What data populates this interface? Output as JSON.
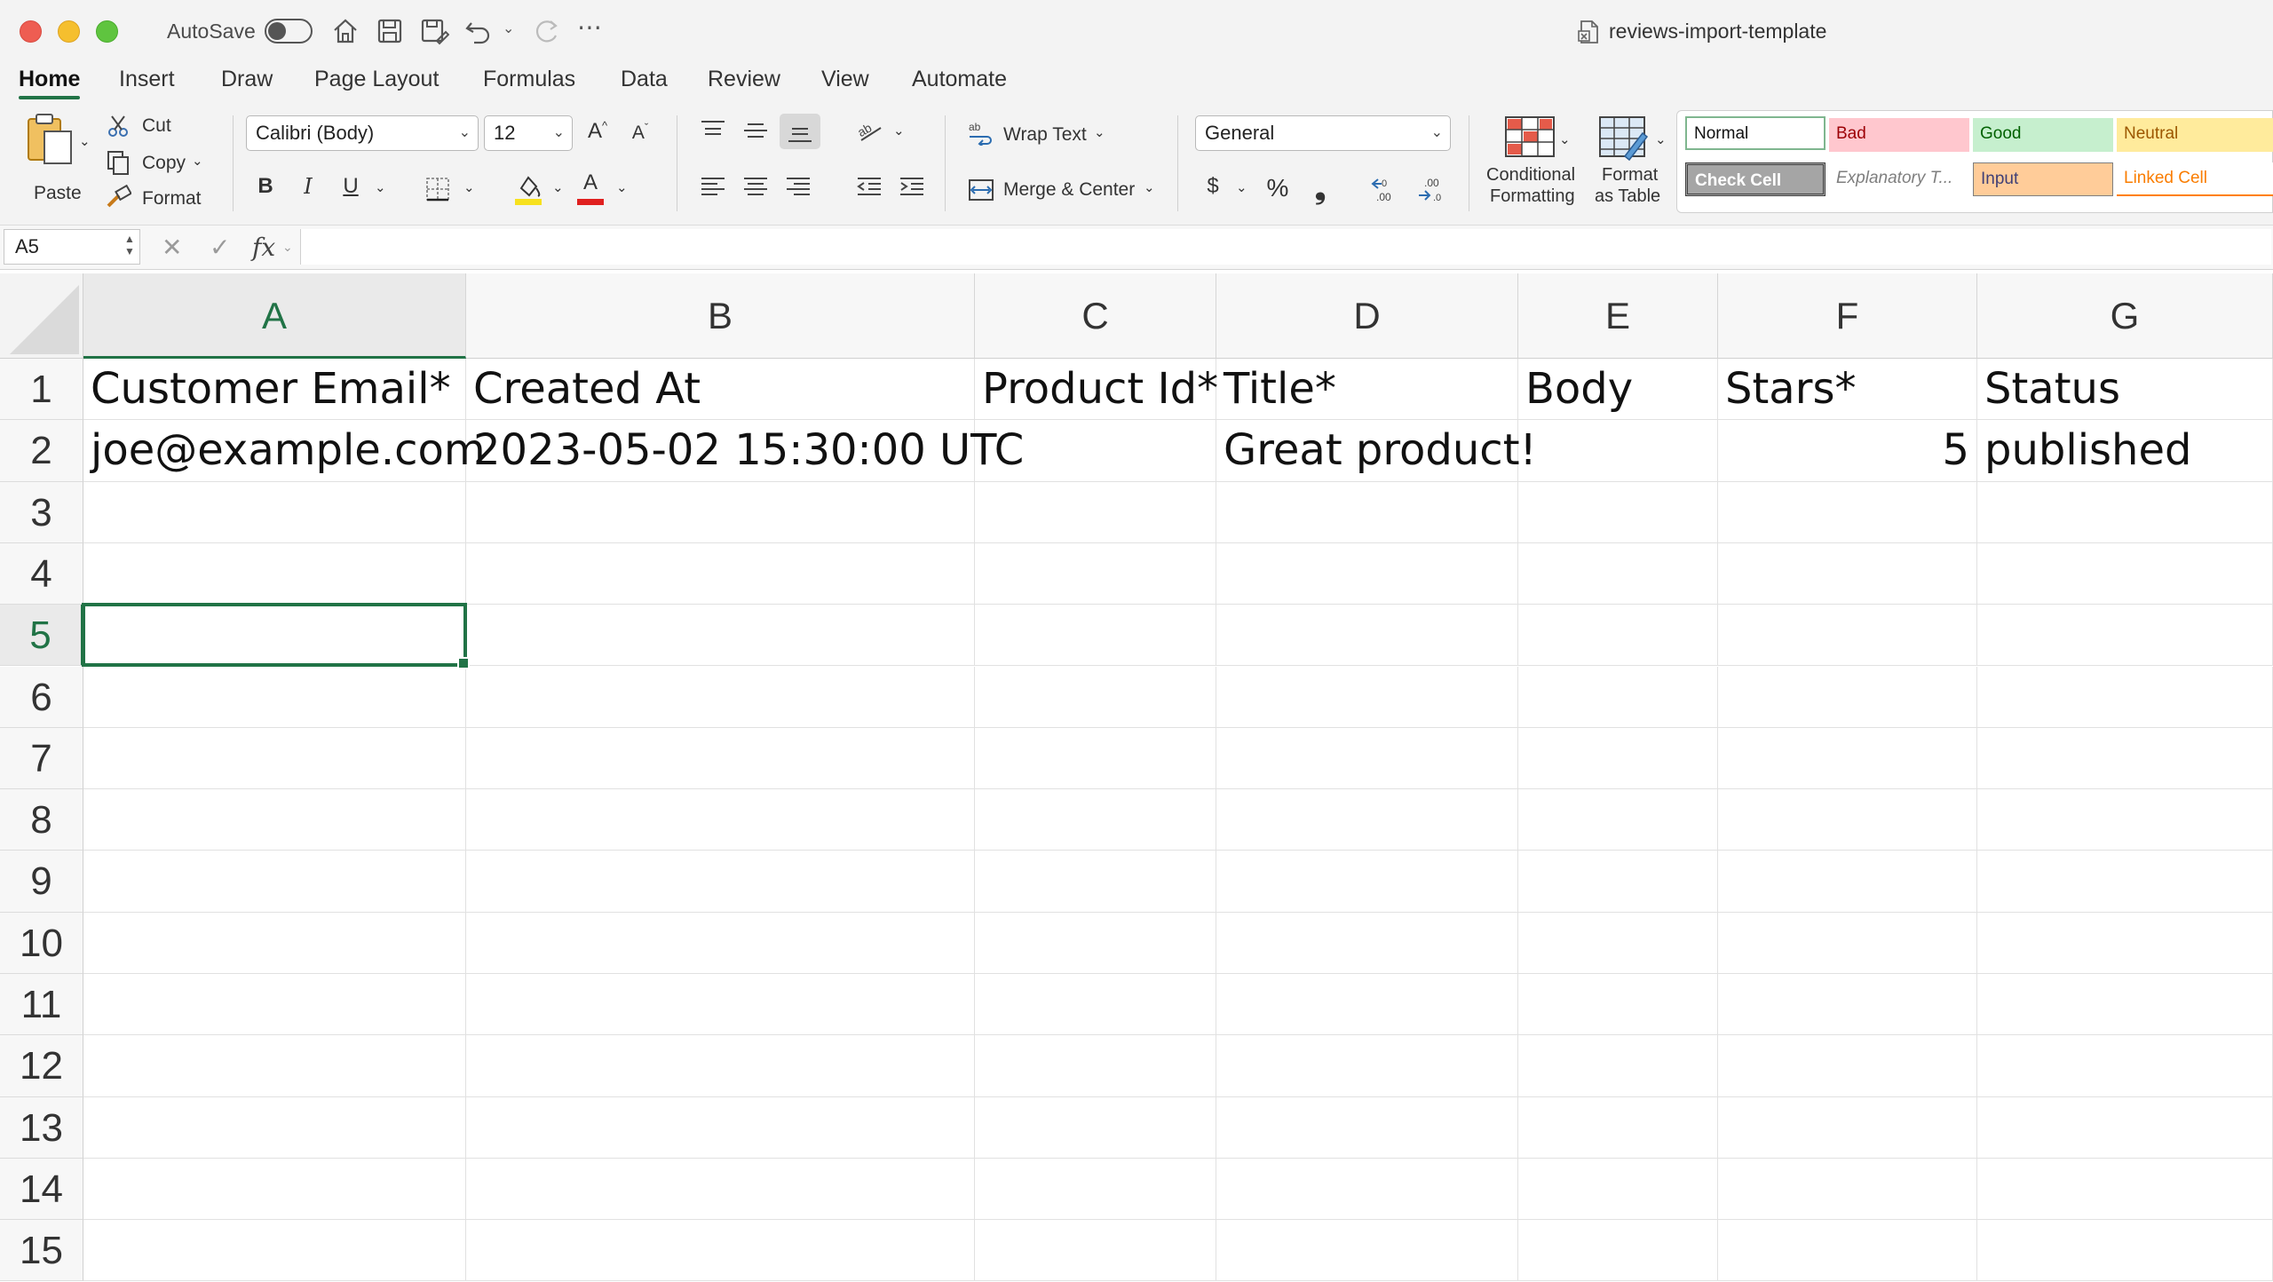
{
  "titlebar": {
    "autosave_label": "AutoSave",
    "autosave_on": false,
    "document_title": "reviews-import-template"
  },
  "menu_tabs": [
    {
      "label": "Home",
      "active": true
    },
    {
      "label": "Insert"
    },
    {
      "label": "Draw"
    },
    {
      "label": "Page Layout"
    },
    {
      "label": "Formulas"
    },
    {
      "label": "Data"
    },
    {
      "label": "Review"
    },
    {
      "label": "View"
    },
    {
      "label": "Automate"
    }
  ],
  "ribbon": {
    "clipboard": {
      "paste": "Paste",
      "cut": "Cut",
      "copy": "Copy",
      "format": "Format"
    },
    "font": {
      "name": "Calibri (Body)",
      "size": "12",
      "bold": "B",
      "italic": "I",
      "underline": "U",
      "font_color_letter": "A"
    },
    "alignment": {
      "wrap_text": "Wrap Text",
      "merge_center": "Merge & Center"
    },
    "number": {
      "format": "General",
      "currency": "$",
      "percent": "%",
      "comma": "❟"
    },
    "styles": {
      "conditional_formatting": [
        "Conditional",
        "Formatting"
      ],
      "format_as_table": [
        "Format",
        "as Table"
      ],
      "cell_styles": [
        {
          "label": "Normal",
          "bg": "#ffffff",
          "fg": "#111111"
        },
        {
          "label": "Bad",
          "bg": "#ffc7ce",
          "fg": "#9c0006"
        },
        {
          "label": "Good",
          "bg": "#c6efce",
          "fg": "#006100"
        },
        {
          "label": "Neutral",
          "bg": "#ffeb9c",
          "fg": "#9c5700"
        },
        {
          "label": "Check Cell",
          "bg": "#a5a5a5",
          "fg": "#ffffff"
        },
        {
          "label": "Explanatory T...",
          "bg": "#f3f3f3",
          "fg": "#7f7f7f"
        },
        {
          "label": "Input",
          "bg": "#ffcc99",
          "fg": "#3f3f76"
        },
        {
          "label": "Linked Cell",
          "bg": "#f3f3f3",
          "fg": "#fa7d00"
        }
      ]
    }
  },
  "formula_bar": {
    "name_box": "A5",
    "fx": "fx",
    "formula": ""
  },
  "sheet": {
    "columns": [
      "A",
      "B",
      "C",
      "D",
      "E",
      "F",
      "G"
    ],
    "selected_column": "A",
    "rows": [
      "1",
      "2",
      "3",
      "4",
      "5",
      "6",
      "7",
      "8",
      "9",
      "10",
      "11",
      "12",
      "13",
      "14",
      "15"
    ],
    "selected_row": "5",
    "active_cell": "A5",
    "cells": {
      "A1": "Customer Email*",
      "B1": "Created At",
      "C1": "Product Id*",
      "D1": "Title*",
      "E1": "Body",
      "F1": "Stars*",
      "G1": "Status",
      "A2": "joe@example.com",
      "B2": "2023-05-02 15:30:00 UTC",
      "D2": "Great product!",
      "F2": "5",
      "G2": "published"
    },
    "numeric_cells": [
      "F2"
    ]
  },
  "colors": {
    "accent": "#217346",
    "ribbon_bg": "#f3f3f3"
  }
}
